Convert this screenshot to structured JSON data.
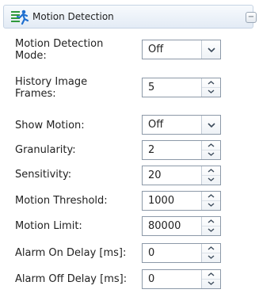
{
  "header": {
    "title": "Motion Detection",
    "icon": "motion-detection-icon",
    "collapse_symbol": "−"
  },
  "fields": [
    {
      "label": "Motion Detection Mode:",
      "value": "Off",
      "control": "dropdown"
    },
    {
      "label": "History Image Frames:",
      "value": "5",
      "control": "spinner"
    },
    {
      "label": "Show Motion:",
      "value": "Off",
      "control": "dropdown"
    },
    {
      "label": "Granularity:",
      "value": "2",
      "control": "spinner"
    },
    {
      "label": "Sensitivity:",
      "value": "20",
      "control": "spinner"
    },
    {
      "label": "Motion Threshold:",
      "value": "1000",
      "control": "spinner"
    },
    {
      "label": "Motion Limit:",
      "value": "80000",
      "control": "spinner"
    },
    {
      "label": "Alarm On Delay [ms]:",
      "value": "0",
      "control": "spinner"
    },
    {
      "label": "Alarm Off Delay [ms]:",
      "value": "0",
      "control": "spinner"
    }
  ],
  "colors": {
    "header_border": "#c6d3e3",
    "control_border": "#8c99a8",
    "icon_blue": "#1f6fd0",
    "icon_green": "#2f9a3c"
  }
}
